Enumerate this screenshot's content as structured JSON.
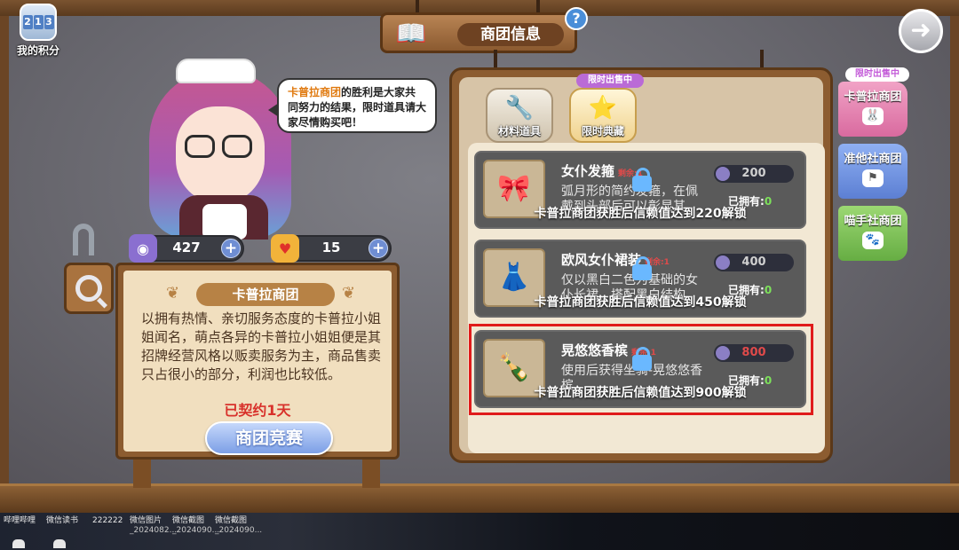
{
  "score": {
    "digits": [
      "2",
      "1",
      "3"
    ],
    "label": "我的积分"
  },
  "title": {
    "text": "商团信息",
    "help_glyph": "?"
  },
  "nav": {
    "next_glyph": "➜"
  },
  "dialog": {
    "highlight": "卡普拉商团",
    "text": "的胜利是大家共同努力的结果，限时道具请大家尽情购买吧！"
  },
  "currency": [
    {
      "icon": "purple-gem-icon",
      "value": "427",
      "plus": "+"
    },
    {
      "icon": "heart-icon",
      "value": "15",
      "plus": "+"
    }
  ],
  "board": {
    "title": "卡普拉商团",
    "description": "以拥有热情、亲切服务态度的卡普拉小姐姐闻名，萌点各异的卡普拉小姐姐便是其招牌经营风格以贩卖服务为主，商品售卖只占很小的部分，利润也比较低。",
    "contract": "已契约1天",
    "compete_button": "商团竞赛"
  },
  "shop": {
    "tabs": [
      {
        "label": "材料道具",
        "icon": "wrench-flask-icon"
      },
      {
        "label": "限时典藏",
        "icon": "star-folder-icon",
        "tag": "限时出售中"
      }
    ],
    "items": [
      {
        "name": "女仆发箍",
        "remain": "剩余:1",
        "desc": "弧月形的简约发箍，在佩戴到头部后可以彰显其",
        "price": "200",
        "owned_label": "已拥有:",
        "owned": "0",
        "lock": "卡普拉商团获胜后信赖值达到220解锁",
        "icon": "maid-headband-icon"
      },
      {
        "name": "欧风女仆裙装",
        "remain": "剩余:1",
        "desc": "仅以黑白二色为基础的女仆长裙，搭配黑白结构",
        "price": "400",
        "owned_label": "已拥有:",
        "owned": "0",
        "lock": "卡普拉商团获胜后信赖值达到450解锁",
        "icon": "maid-dress-icon"
      },
      {
        "name": "晃悠悠香槟",
        "remain": "剩余:1",
        "desc": "使用后获得坐骑-晃悠悠香槟",
        "price": "800",
        "owned_label": "已拥有:",
        "owned": "0",
        "lock": "卡普拉商团获胜后信赖值达到900解锁",
        "icon": "champagne-bottle-icon"
      }
    ]
  },
  "side_tabs": {
    "tag": "限时出售中",
    "items": [
      {
        "label": "卡普拉商团",
        "icon": "rabbit-icon"
      },
      {
        "label": "准他社商团",
        "icon": "guild-icon"
      },
      {
        "label": "喵手社商团",
        "icon": "paw-icon"
      }
    ]
  },
  "taskbar": [
    {
      "label": "哔哩哔哩",
      "sub": ""
    },
    {
      "label": "微信读书",
      "sub": ""
    },
    {
      "label": "222222",
      "sub": ""
    },
    {
      "label": "微信图片",
      "sub": "_2024082..."
    },
    {
      "label": "微信截图",
      "sub": "_2024090..."
    },
    {
      "label": "微信截图",
      "sub": "_2024090..."
    }
  ],
  "colors": {
    "highlight_box": "#e01b1b",
    "accent_orange": "#e07a10",
    "contract_red": "#d8312b"
  }
}
